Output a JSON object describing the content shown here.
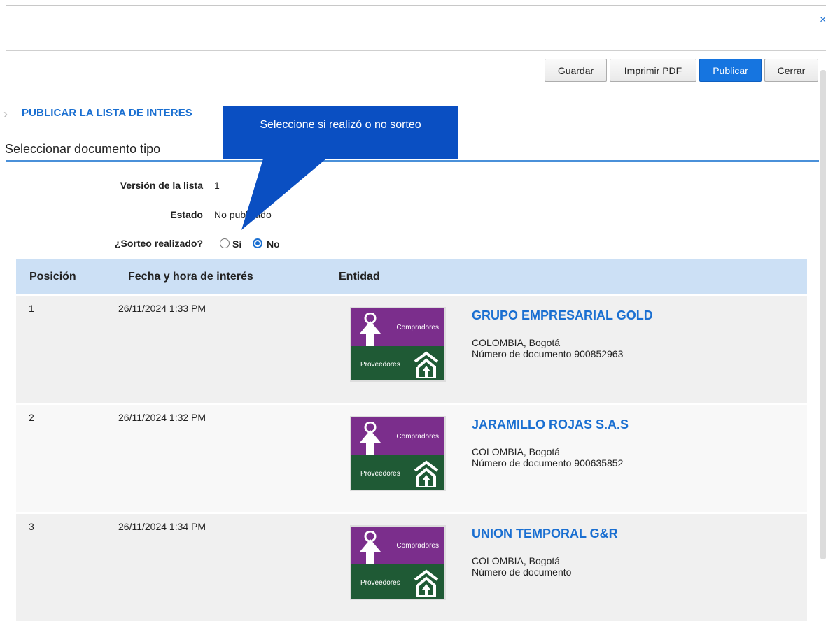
{
  "window": {
    "close_symbol": "×"
  },
  "toolbar": {
    "save": "Guardar",
    "print_pdf": "Imprimir PDF",
    "publish": "Publicar",
    "close": "Cerrar"
  },
  "section": {
    "title": "PUBLICAR LA LISTA DE INTERES",
    "subheader": "Seleccionar documento tipo"
  },
  "fields": {
    "version_label": "Versión de la lista",
    "version_value": "1",
    "status_label": "Estado",
    "status_value": "No publicado",
    "draw_label": "¿Sorteo realizado?",
    "draw_yes": "Sí",
    "draw_no": "No",
    "draw_selected": "No"
  },
  "callout": {
    "text": "Seleccione si realizó o no sorteo"
  },
  "table": {
    "headers": {
      "position": "Posición",
      "date": "Fecha y hora de interés",
      "entity": "Entidad"
    },
    "logo": {
      "top_text": "Compradores",
      "bottom_text": "Proveedores"
    },
    "rows": [
      {
        "position": "1",
        "date": "26/11/2024 1:33 PM",
        "name": "GRUPO EMPRESARIAL GOLD",
        "location": "COLOMBIA, Bogotá",
        "document": "Número de documento 900852963"
      },
      {
        "position": "2",
        "date": "26/11/2024 1:32 PM",
        "name": "JARAMILLO ROJAS S.A.S",
        "location": "COLOMBIA, Bogotá",
        "document": "Número de documento 900635852"
      },
      {
        "position": "3",
        "date": "26/11/2024 1:34 PM",
        "name": "UNION TEMPORAL G&R",
        "location": "COLOMBIA, Bogotá",
        "document": "Número de documento"
      }
    ]
  },
  "colors": {
    "accent": "#1a6fd1",
    "callout": "#0a4fc2",
    "table_header": "#cce0f5",
    "logo_purple": "#7b2e8c",
    "logo_green": "#1f5a35"
  }
}
